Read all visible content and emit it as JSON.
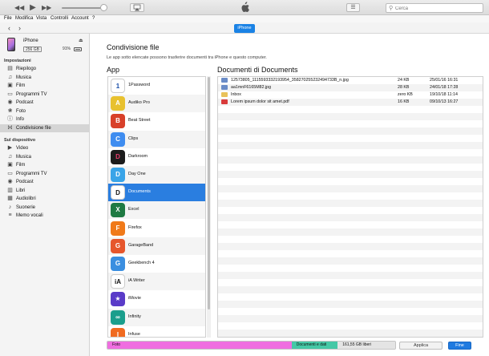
{
  "toolbar": {
    "rewind_icon": "rewind-icon",
    "play_icon": "play-icon",
    "forward_icon": "fast-forward-icon",
    "search_placeholder": "Cerca",
    "search_value": ""
  },
  "menu": [
    "File",
    "Modifica",
    "Vista",
    "Controlli",
    "Account",
    "?"
  ],
  "nav": {
    "device_pill": "iPhone"
  },
  "device": {
    "name": "iPhone",
    "capacity": "256 GB",
    "battery": "91%"
  },
  "sidebar": {
    "settings_header": "Impostazioni",
    "settings_items": [
      {
        "label": "Riepilogo",
        "icon": "summary-icon"
      },
      {
        "label": "Musica",
        "icon": "music-icon"
      },
      {
        "label": "Film",
        "icon": "film-icon"
      },
      {
        "label": "Programmi TV",
        "icon": "tv-icon"
      },
      {
        "label": "Podcast",
        "icon": "podcast-icon"
      },
      {
        "label": "Foto",
        "icon": "photo-icon"
      },
      {
        "label": "Info",
        "icon": "info-icon"
      },
      {
        "label": "Condivisione file",
        "icon": "file-sharing-icon",
        "active": true
      }
    ],
    "device_header": "Sul dispositivo",
    "device_items": [
      {
        "label": "Video",
        "icon": "video-icon"
      },
      {
        "label": "Musica",
        "icon": "music-icon"
      },
      {
        "label": "Film",
        "icon": "film-icon"
      },
      {
        "label": "Programmi TV",
        "icon": "tv-icon"
      },
      {
        "label": "Podcast",
        "icon": "podcast-icon"
      },
      {
        "label": "Libri",
        "icon": "books-icon"
      },
      {
        "label": "Audiolibri",
        "icon": "audiobooks-icon"
      },
      {
        "label": "Suonerie",
        "icon": "ringtones-icon"
      },
      {
        "label": "Memo vocali",
        "icon": "voice-memo-icon"
      }
    ]
  },
  "main": {
    "title": "Condivisione file",
    "description": "Le app sotto elencate possono trasferire documenti tra iPhone e questo computer.",
    "apps_header": "App",
    "docs_header": "Documenti di Documents",
    "apps": [
      {
        "name": "1Password",
        "color": "#ffffff",
        "fg": "#1a4ea8",
        "glyph": "1"
      },
      {
        "name": "Audiko Pro",
        "color": "#e8c12f",
        "fg": "#ffffff",
        "glyph": "A"
      },
      {
        "name": "Beat Street",
        "color": "#d8402a",
        "fg": "#ffffff",
        "glyph": "B"
      },
      {
        "name": "Clips",
        "color": "#3f8df0",
        "fg": "#ffffff",
        "glyph": "C"
      },
      {
        "name": "Darkroom",
        "color": "#1c1c1c",
        "fg": "#e83d6c",
        "glyph": "D"
      },
      {
        "name": "Day One",
        "color": "#39a4e8",
        "fg": "#ffffff",
        "glyph": "D"
      },
      {
        "name": "Documents",
        "color": "#ffffff",
        "fg": "#111111",
        "glyph": "D",
        "selected": true
      },
      {
        "name": "Excel",
        "color": "#1f7a43",
        "fg": "#ffffff",
        "glyph": "X"
      },
      {
        "name": "Firefox",
        "color": "#f07a1a",
        "fg": "#ffffff",
        "glyph": "F"
      },
      {
        "name": "GarageBand",
        "color": "#e6562c",
        "fg": "#ffffff",
        "glyph": "G"
      },
      {
        "name": "Geekbench 4",
        "color": "#3a8ee0",
        "fg": "#ffffff",
        "glyph": "G"
      },
      {
        "name": "iA Writer",
        "color": "#ffffff",
        "fg": "#111111",
        "glyph": "iA"
      },
      {
        "name": "iMovie",
        "color": "#5a3bc8",
        "fg": "#ffffff",
        "glyph": "★"
      },
      {
        "name": "Infinity",
        "color": "#1a9e8c",
        "fg": "#ffffff",
        "glyph": "∞"
      },
      {
        "name": "Infuse",
        "color": "#f06a20",
        "fg": "#ffffff",
        "glyph": "I"
      }
    ],
    "documents": [
      {
        "name": "12573805_1115593332193954_358270255232494733B_n.jpg",
        "size": "24 KB",
        "date": "25/01/16 16:31",
        "color": "#6a8cc7"
      },
      {
        "name": "aa1mnF6165M82.jpg",
        "size": "28 KB",
        "date": "24/01/18 17:28",
        "color": "#6a8cc7"
      },
      {
        "name": "Inbox",
        "size": "zero KB",
        "date": "19/10/18 11:14",
        "color": "#e9c25a"
      },
      {
        "name": "Lorem ipsum dolor sit amet.pdf",
        "size": "16 KB",
        "date": "09/10/13 16:27",
        "color": "#d83b3b"
      }
    ]
  },
  "storage": {
    "segments": [
      {
        "label": "Foto",
        "color": "#ef6ee0",
        "fraction": 0.64
      },
      {
        "label": "Documenti e dati",
        "color": "#45c8a6",
        "fraction": 0.16
      },
      {
        "label": "161,55 GB liberi",
        "color": "#e4e4e4",
        "fraction": 0.2
      }
    ]
  },
  "buttons": {
    "apply": "Applica",
    "done": "Fine"
  }
}
